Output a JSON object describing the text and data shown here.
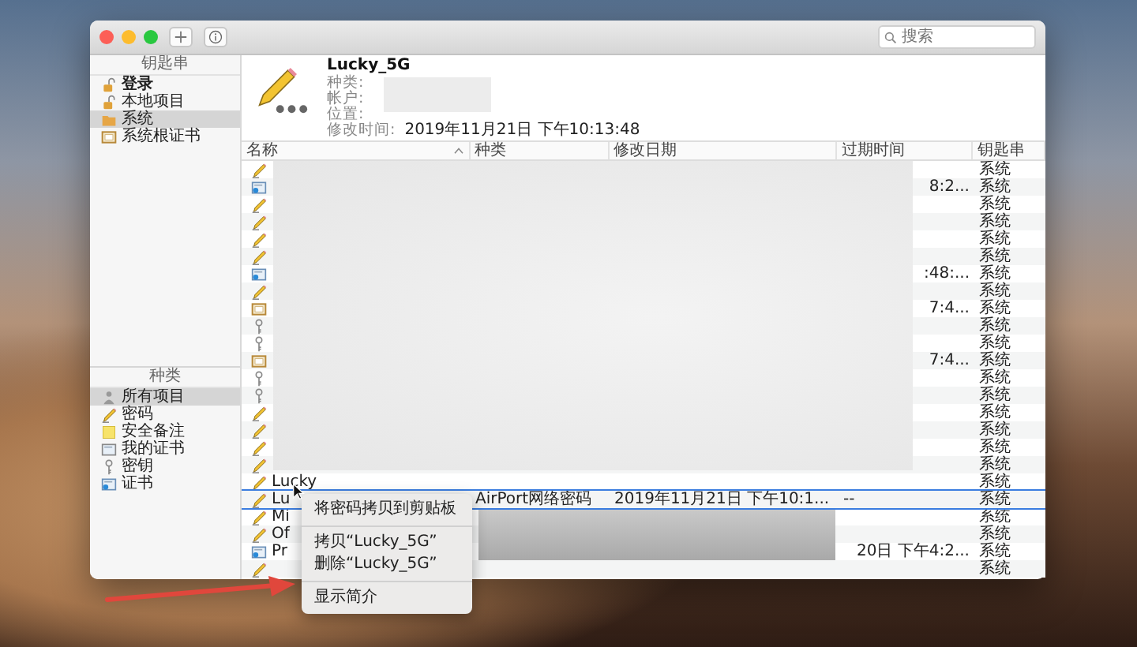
{
  "window": {
    "search": {
      "placeholder": "搜索"
    },
    "sidebar": {
      "keychains": {
        "header": "钥匙串",
        "items": [
          {
            "label": "登录",
            "kind": "keychain_unlocked",
            "default": true,
            "selected": false
          },
          {
            "label": "本地项目",
            "kind": "keychain_unlocked",
            "default": false,
            "selected": false
          },
          {
            "label": "系统",
            "kind": "keychain_system",
            "default": false,
            "selected": true
          },
          {
            "label": "系统根证书",
            "kind": "certificate_store",
            "default": false,
            "selected": false
          }
        ]
      },
      "categories": {
        "header": "种类",
        "items": [
          {
            "label": "所有项目",
            "kind": "all",
            "selected": true
          },
          {
            "label": "密码",
            "kind": "password",
            "selected": false
          },
          {
            "label": "安全备注",
            "kind": "secure_note",
            "selected": false
          },
          {
            "label": "我的证书",
            "kind": "my_certificate",
            "selected": false
          },
          {
            "label": "密钥",
            "kind": "key",
            "selected": false
          },
          {
            "label": "证书",
            "kind": "certificate",
            "selected": false
          }
        ]
      }
    },
    "detail": {
      "name": "Lucky_5G",
      "values_redacted": true,
      "fields": [
        {
          "label": "种类:"
        },
        {
          "label": "帐户:"
        },
        {
          "label": "位置:"
        },
        {
          "label": "修改时间:",
          "value": "2019年11月21日 下午10:13:48"
        }
      ]
    },
    "table": {
      "columns": [
        {
          "label": "名称",
          "sorted": true
        },
        {
          "label": "种类",
          "sorted": false
        },
        {
          "label": "修改日期",
          "sorted": false
        },
        {
          "label": "过期时间",
          "sorted": false
        },
        {
          "label": "钥匙串",
          "sorted": false
        }
      ],
      "rows": [
        {
          "kind": "password",
          "selected": false,
          "keychain": "系统"
        },
        {
          "kind": "certificate",
          "selected": false,
          "expires": "8:2...",
          "keychain": "系统"
        },
        {
          "kind": "password",
          "selected": false,
          "keychain": "系统"
        },
        {
          "kind": "password",
          "selected": false,
          "keychain": "系统"
        },
        {
          "kind": "password",
          "selected": false,
          "keychain": "系统"
        },
        {
          "kind": "password",
          "selected": false,
          "keychain": "系统"
        },
        {
          "kind": "certificate",
          "selected": false,
          "expires": ":48:...",
          "keychain": "系统"
        },
        {
          "kind": "password",
          "selected": false,
          "keychain": "系统"
        },
        {
          "kind": "certificate_authority",
          "selected": false,
          "expires": "7:4...",
          "keychain": "系统"
        },
        {
          "kind": "key",
          "selected": false,
          "keychain": "系统"
        },
        {
          "kind": "key",
          "selected": false,
          "keychain": "系统"
        },
        {
          "kind": "certificate_authority",
          "selected": false,
          "expires": "7:4...",
          "keychain": "系统"
        },
        {
          "kind": "key",
          "selected": false,
          "keychain": "系统"
        },
        {
          "kind": "key",
          "selected": false,
          "keychain": "系统"
        },
        {
          "kind": "password",
          "selected": false,
          "keychain": "系统"
        },
        {
          "kind": "password",
          "selected": false,
          "keychain": "系统"
        },
        {
          "kind": "password",
          "selected": false,
          "keychain": "系统"
        },
        {
          "kind": "password",
          "selected": false,
          "keychain": "系统"
        },
        {
          "kind": "password",
          "selected": false,
          "name": "Lucky",
          "keychain": "系统"
        },
        {
          "kind": "password",
          "selected": true,
          "name": "Lu",
          "type": "AirPort网络密码",
          "date": "2019年11月21日 下午10:1...",
          "expires": "--",
          "keychain": "系统"
        },
        {
          "kind": "password",
          "selected": false,
          "name": "Mi",
          "keychain": "系统"
        },
        {
          "kind": "password",
          "selected": false,
          "name": "Of",
          "keychain": "系统"
        },
        {
          "kind": "certificate",
          "selected": false,
          "name": "Pr",
          "expires": "20日 下午4:2...",
          "keychain": "系统"
        },
        {
          "kind": "password",
          "selected": false,
          "keychain": "系统"
        }
      ]
    },
    "context_menu": {
      "items": [
        {
          "kind": "item",
          "label": "将密码拷贝到剪贴板"
        },
        {
          "kind": "separator"
        },
        {
          "kind": "item",
          "label": "拷贝“Lucky_5G”"
        },
        {
          "kind": "item",
          "label": "删除“Lucky_5G”"
        },
        {
          "kind": "separator"
        },
        {
          "kind": "item",
          "label": "显示简介"
        }
      ]
    }
  }
}
